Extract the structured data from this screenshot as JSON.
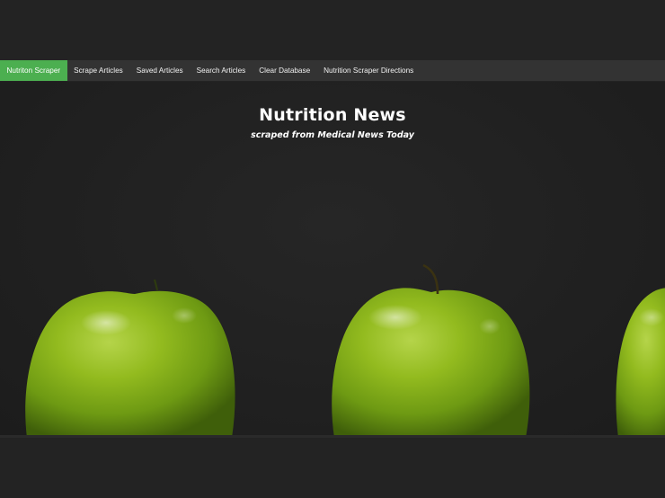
{
  "nav": {
    "items": [
      {
        "label": "Nutriton Scraper",
        "active": true
      },
      {
        "label": "Scrape Articles",
        "active": false
      },
      {
        "label": "Saved Articles",
        "active": false
      },
      {
        "label": "Search Articles",
        "active": false
      },
      {
        "label": "Clear Database",
        "active": false
      },
      {
        "label": "Nutrition Scraper Directions",
        "active": false
      }
    ]
  },
  "hero": {
    "title": "Nutrition News",
    "subtitle": "scraped from Medical News Today",
    "image": "green-apples-photo"
  },
  "colors": {
    "background": "#232323",
    "navbar": "#333333",
    "active": "#4caf50"
  }
}
